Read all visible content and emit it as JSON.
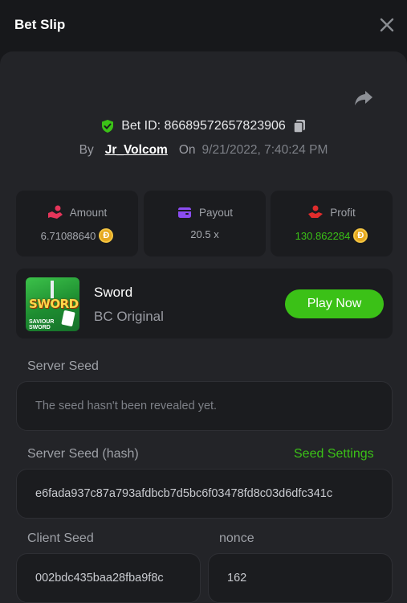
{
  "header": {
    "title": "Bet Slip",
    "close_icon": "close-icon"
  },
  "bet": {
    "id_label": "Bet ID: 86689572657823906",
    "by_label": "By",
    "user": "Jr_Volcom",
    "on_label": "On",
    "date": "9/21/2022, 7:40:24 PM"
  },
  "stats": {
    "amount": {
      "label": "Amount",
      "value": "6.71088640",
      "icon": "hand-coins-icon",
      "icon_color": "#e5355a"
    },
    "payout": {
      "label": "Payout",
      "value": "20.5 x",
      "icon": "wallet-icon",
      "icon_color": "#8b4cf0"
    },
    "profit": {
      "label": "Profit",
      "value": "130.862284",
      "icon": "hand-up-icon",
      "icon_color": "#e02c2c",
      "value_color": "#3bc117"
    },
    "currency_symbol": "Đ"
  },
  "game": {
    "thumb_title": "SWORD",
    "thumb_subtitle_1": "SAVIOUR",
    "thumb_subtitle_2": "SWORD",
    "name": "Sword",
    "provider": "BC Original",
    "play_label": "Play Now"
  },
  "fairness": {
    "server_seed_label": "Server Seed",
    "server_seed_value": "The seed hasn't been revealed yet.",
    "server_hash_label": "Server Seed (hash)",
    "seed_settings_label": "Seed Settings",
    "server_hash_value": "e6fada937c87a793afdbcb7d5bc6f03478fd8c03d6dfc341c",
    "client_seed_label": "Client Seed",
    "client_seed_value": "002bdc435baa28fba9f8c",
    "nonce_label": "nonce",
    "nonce_value": "162"
  },
  "colors": {
    "accent": "#3bc117",
    "panel": "#232428",
    "card": "#1b1c1f",
    "shield": "#3bc117"
  }
}
